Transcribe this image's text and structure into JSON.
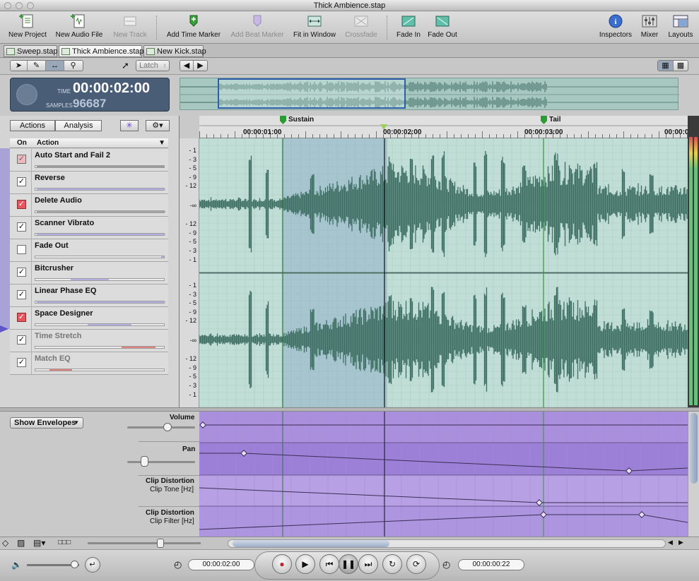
{
  "window": {
    "title": "Thick Ambience.stap"
  },
  "toolbar": {
    "items": [
      {
        "label": "New Project",
        "icon": "new-project-icon",
        "enabled": true
      },
      {
        "label": "New Audio File",
        "icon": "new-audio-file-icon",
        "enabled": true
      },
      {
        "label": "New Track",
        "icon": "new-track-icon",
        "enabled": false
      },
      {
        "label": "Add Time Marker",
        "icon": "time-marker-icon",
        "enabled": true
      },
      {
        "label": "Add Beat Marker",
        "icon": "beat-marker-icon",
        "enabled": false
      },
      {
        "label": "Fit in Window",
        "icon": "fit-window-icon",
        "enabled": true
      },
      {
        "label": "Crossfade",
        "icon": "crossfade-icon",
        "enabled": false
      },
      {
        "label": "Fade In",
        "icon": "fade-in-icon",
        "enabled": true
      },
      {
        "label": "Fade Out",
        "icon": "fade-out-icon",
        "enabled": true
      },
      {
        "label": "Inspectors",
        "icon": "info-icon",
        "enabled": true
      },
      {
        "label": "Mixer",
        "icon": "mixer-icon",
        "enabled": true
      },
      {
        "label": "Layouts",
        "icon": "layouts-icon",
        "enabled": true
      }
    ]
  },
  "tabs": [
    {
      "label": "Sweep.stap",
      "active": false
    },
    {
      "label": "Thick Ambience.stap",
      "active": true
    },
    {
      "label": "New Kick.stap",
      "active": false
    }
  ],
  "toolrow": {
    "latch": "Latch"
  },
  "timedisplay": {
    "time_label": "TIME",
    "time": "00:00:02:00",
    "samples_label": "SAMPLES",
    "samples": "96687"
  },
  "actions_panel": {
    "tabs": [
      "Actions",
      "Analysis"
    ],
    "col_on": "On",
    "col_action": "Action",
    "rows": [
      {
        "name": "Auto Start and Fail 2",
        "checked": true,
        "style": "redlight",
        "dim": false
      },
      {
        "name": "Reverse",
        "checked": true,
        "style": "normal",
        "dim": false
      },
      {
        "name": "Delete Audio",
        "checked": true,
        "style": "red",
        "dim": false
      },
      {
        "name": "Scanner Vibrato",
        "checked": true,
        "style": "normal",
        "dim": false
      },
      {
        "name": "Fade Out",
        "checked": false,
        "style": "normal",
        "dim": false
      },
      {
        "name": "Bitcrusher",
        "checked": true,
        "style": "normal",
        "dim": false
      },
      {
        "name": "Linear Phase EQ",
        "checked": true,
        "style": "normal",
        "dim": false
      },
      {
        "name": "Space Designer",
        "checked": true,
        "style": "red",
        "dim": false
      },
      {
        "name": "Time Stretch",
        "checked": true,
        "style": "normal",
        "dim": true
      },
      {
        "name": "Match EQ",
        "checked": true,
        "style": "normal",
        "dim": true
      }
    ]
  },
  "ruler": {
    "markers": [
      "Sustain",
      "Tail"
    ],
    "ticks": [
      "00:00:01:00",
      "00:00:02:00",
      "00:00:03:00",
      "00:00:0"
    ]
  },
  "db_scale": [
    "- 1",
    "- 3",
    "- 5",
    "- 9",
    "- 12",
    "-∞",
    "- 12",
    "- 9",
    "- 5",
    "- 3",
    "- 1"
  ],
  "envelopes": {
    "show_label": "Show Envelopes",
    "volume": "Volume",
    "pan": "Pan",
    "clip1_title": "Clip Distortion",
    "clip1_param": "Clip Tone [Hz]",
    "clip2_title": "Clip Distortion",
    "clip2_param": "Clip Filter [Hz]"
  },
  "transport": {
    "position": "00:00:02:00",
    "length": "00:00:00:22"
  },
  "colors": {
    "waveform_bg": "#c0ded6",
    "waveform": "#3e6e62",
    "selection": "#8fb0c8",
    "envelope_bg": "#b9a3e3",
    "marker_green": "#2e9a34"
  }
}
